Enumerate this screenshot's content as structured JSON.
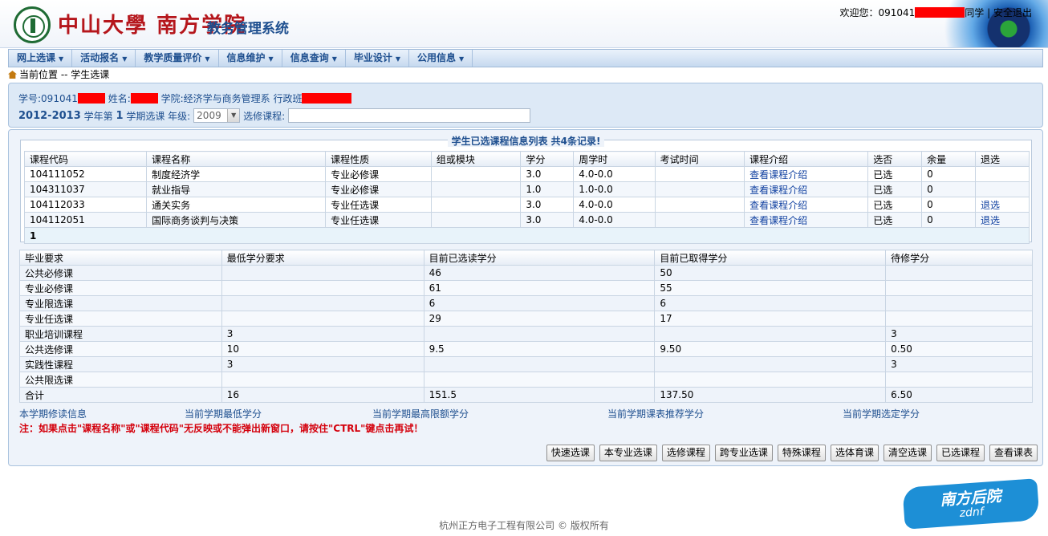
{
  "header": {
    "university": "中山大學",
    "college": "南方学院",
    "system": "教务管理系统",
    "welcome_prefix": "欢迎您：091041",
    "welcome_suffix": "同学",
    "logout": "安全退出"
  },
  "nav": [
    {
      "label": "网上选课"
    },
    {
      "label": "活动报名"
    },
    {
      "label": "教学质量评价"
    },
    {
      "label": "信息维护"
    },
    {
      "label": "信息查询"
    },
    {
      "label": "毕业设计"
    },
    {
      "label": "公用信息"
    }
  ],
  "breadcrumb": {
    "text": "当前位置 -- 学生选课"
  },
  "student": {
    "id_label": "学号:091041",
    "name_label": "姓名:",
    "college_label": "学院:经济学与商务管理系",
    "class_label": "行政班"
  },
  "term": {
    "year": "2012-2013",
    "year_suffix": "学年第",
    "term_no": "1",
    "term_suffix": "学期选课 年级:",
    "grade": "2009",
    "course_label": "选修课程:",
    "course_value": ""
  },
  "selected": {
    "title": "学生已选课程信息列表 共4条记录!",
    "headers": [
      "课程代码",
      "课程名称",
      "课程性质",
      "组或模块",
      "学分",
      "周学时",
      "考试时间",
      "课程介绍",
      "选否",
      "余量",
      "退选"
    ],
    "rows": [
      [
        "104111052",
        "制度经济学",
        "专业必修课",
        "",
        "3.0",
        "4.0-0.0",
        "",
        "查看课程介绍",
        "已选",
        "0",
        ""
      ],
      [
        "104311037",
        "就业指导",
        "专业必修课",
        "",
        "1.0",
        "1.0-0.0",
        "",
        "查看课程介绍",
        "已选",
        "0",
        ""
      ],
      [
        "104112033",
        "通关实务",
        "专业任选课",
        "",
        "3.0",
        "4.0-0.0",
        "",
        "查看课程介绍",
        "已选",
        "0",
        "退选"
      ],
      [
        "104112051",
        "国际商务谈判与决策",
        "专业任选课",
        "",
        "3.0",
        "4.0-0.0",
        "",
        "查看课程介绍",
        "已选",
        "0",
        "退选"
      ]
    ],
    "page": "1"
  },
  "credits": {
    "headers": [
      "毕业要求",
      "最低学分要求",
      "目前已选读学分",
      "目前已取得学分",
      "待修学分"
    ],
    "rows": [
      [
        "公共必修课",
        "",
        "46",
        "50",
        ""
      ],
      [
        "专业必修课",
        "",
        "61",
        "55",
        ""
      ],
      [
        "专业限选课",
        "",
        "6",
        "6",
        ""
      ],
      [
        "专业任选课",
        "",
        "29",
        "17",
        ""
      ],
      [
        "职业培训课程",
        "3",
        "",
        "",
        "3"
      ],
      [
        "公共选修课",
        "10",
        "9.5",
        "9.50",
        "0.50"
      ],
      [
        "实践性课程",
        "3",
        "",
        "",
        "3"
      ],
      [
        "公共限选课",
        "",
        "",
        "",
        ""
      ],
      [
        "合计",
        "16",
        "151.5",
        "137.50",
        "6.50"
      ]
    ]
  },
  "summary": [
    "本学期修读信息",
    "当前学期最低学分",
    "当前学期最高限额学分",
    "当前学期课表推荐学分",
    "当前学期选定学分"
  ],
  "note": "注：如果点击\"课程名称\"或\"课程代码\"无反映或不能弹出新窗口，请按住\"CTRL\"键点击再试！",
  "buttons": [
    "快速选课",
    "本专业选课",
    "选修课程",
    "跨专业选课",
    "特殊课程",
    "选体育课",
    "清空选课",
    "已选课程",
    "查看课表"
  ],
  "brand": {
    "line1": "南方后院",
    "line2": "zdnf"
  },
  "footer": "杭州正方电子工程有限公司 © 版权所有"
}
